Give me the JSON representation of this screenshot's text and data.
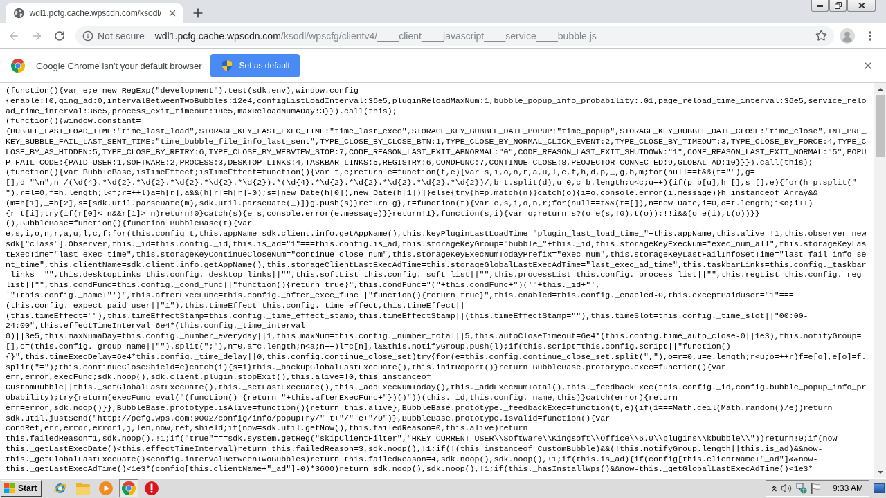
{
  "tabs": [
    {
      "title": "wdl1.pcfg.cache.wpscdn.com/ksodl/",
      "selected": true
    }
  ],
  "nav_buttons": [
    {
      "kind": "back",
      "disabled": true
    },
    {
      "kind": "forward",
      "disabled": true
    },
    {
      "kind": "reload",
      "disabled": false
    }
  ],
  "address_bar": {
    "security": "Not secure",
    "host": "wdl1.pcfg.cache.wpscdn.com",
    "path": "/ksodl/wpscfg/clientv4/____client____javascript____service____bubble.js"
  },
  "infobar": {
    "message": "Google Chrome isn't your default browser",
    "button": "Set as default"
  },
  "source_lines": [
    "(function(){var e;e=new RegExp(\"development\").test(sdk.env),window.config=",
    "{enable:!0,qing_ad:0,intervalBetweenTwoBubbles:12e4,configListLoadInterval:36e5,pluginReloadMaxNum:1,bubble_popup_info_probability:.01,page_reload_time_interval:36e5,service_relo",
    "ad_time_interval:36e5,process_exit_timeout:18e5,maxReloadNumADay:3}}).call(this);",
    "(function(){window.constant=",
    "{BUBBLE_LAST_LOAD_TIME:\"time_last_load\",STORAGE_KEY_LAST_EXEC_TIME:\"time_last_exec\",STORAGE_KEY_BUBBLE_DATE_POPUP:\"time_popup\",STORAGE_KEY_BUBBLE_DATE_CLOSE:\"time_close\",INI_PRE_",
    "KEY_BUBBLE_FAIL_LAST_SENT_TIME:\"time_bubble_file_info_last_sent\",TYPE_CLOSE_BY_CLOSE_BTN:1,TYPE_CLOSE_BY_NORMAL_CLICK_EVENT:2,TYPE_CLOSE_BY_TIMEOUT:3,TYPE_CLOSE_BY_FORCE:4,TYPE_C",
    "LOSE_BY_AS_HIDDEN:5,TYPE_CLOSE_BY_RETRY:6,TYPE_CLOSE_BY_WEBVIEW_STOP:7,CODE_REASON_LAST_EXIT_ABNORMAL:\"0\",CODE_REASON_LAST_EXIT_SHUTDOWN:\"1\",CONE_REASON_LAST_EXIT_NORMAL:\"5\",POPU",
    "P_FAIL_CODE:{PAID_USER:1,SOFTWARE:2,PROCESS:3,DESKTOP_LINKS:4,TASKBAR_LINKS:5,REGISTRY:6,CONDFUNC:7,CONTINUE_CLOSE:8,PEOJECTOR_CONNECTED:9,GLOBAL_AD:10}}}).call(this);",
    "(function(){var BubbleBase,isTimeEffect;isTimeEffect=function(){var t,e;return e=function(t,e){var s,i,o,n,r,a,u,l,c,f,h,d,p,_,g,b,m;for(null==t&&(t=\"\"),g=",
    "[],d=\"\\n\",n=/(\\d{4}.*\\d{2}.*\\d{2}.*\\d{2}.*\\d{2}.*\\d{2}).*(\\d{4}.*\\d{2}.*\\d{2}.*\\d{2}.*\\d{2}.*\\d{2})/,b=t.split(d),u=0,c=b.length;u<c;u++){if(p=b[u],h=[],s=[],e){for(h=p.split(\"-",
    "\"),r=l=0,f=h.length;l<f;r=++l)a=h[r],a&&(h[r]=h[r]-0);s=[new Date(h[0]),new Date(h[1])]}else{try{h=p.match(n)}catch(o){i=o,console.error(i.message)}h instanceof Array&&",
    "(m=h[1],_=h[2],s=[sdk.util.parseDate(m),sdk.util.parseDate(_)]}g.push(s)}return g},t=function(t){var e,s,i,o,n,r;for(null==t&&(t=[]),n=new Date,i=0,o=t.length;i<o;i++)",
    "{r=t[i];try{if(r[0]<=n&&r[1]>=n)return!0}catch(s){e=s,console.error(e.message)}}return!1},function(s,i){var o;return s?(o=e(s,!0),t(o)):!!i&&(o=e(i),t(o))}}",
    "(),BubbleBase=function(){function BubbleBase(t){var",
    "e,s,i,o,n,r,a,u,l,c,f;for(this.config=t,this.appName=sdk.client.info.getAppName(),this.keyPluginLastLoadTime=\"plugin_last_load_time_\"+this.appName,this.alive=!1,this.observer=new",
    "sdk[\"class\"].Observer,this._id=this.config._id,this.is_ad=\"1\"===this.config.is_ad,this.storageKeyGroup=\"bubble_\"+this._id,this.storageKeyExecNum=\"exec_num_all\",this.storageKeyLas",
    "tExecTime=\"last_exec_time\",this.storageKeyContinueCloseNum=\"continue_close_num\",this.storageKeyExecNumTodayPrefix=\"exec_num\",this.storageKeyLastFailInfoSetTime=\"last_fail_info_se",
    "nt_time\",this.clientName=sdk.client.info.getAppName(),this.storageClientLastExecAdTime=this.storageGlobalLastExecAdTime=\"last_exec_ad_time\",this.taskbarLinks=this.config._taskbar",
    "_links||\"\",this.desktopLinks=this.config._desktop_links||\"\",this.softList=this.config._soft_list||\"\",this.processList=this.config._process_list||\"\",this.regList=this.config._reg_",
    "list||\"\",this.condFunc=this.config._cond_func||\"function(){return true}\",this.condFunc=\"(\"+this.condFunc+\")('\"+this._id+\"',",
    "'\"+this.config._name+\"')\",this.afterExecFunc=this.config._after_exec_func||\"function(){return true}\",this.enabled=this.config._enabled-0,this.exceptPaidUser=\"1\"===",
    "(this.config._expect_paid_user||\"1\"),this.timeEffect=this.config._time_effect,this.timeEffect||",
    "(this.timeEffect=\"\"),this.timeEffectStamp=this.config._time_effect_stamp,this.timeEffectStamp||(this.timeEffectStamp=\"\"),this.timeSlot=this.config._time_slot||\"00:00-",
    "24:00\",this.effectTimeInterval=6e4*(this.config._time_interval-",
    "0)||3e5,this.maxNumaDay=this.config._number_everyday||1,this.maxNum=this.config._number_total||5,this.autoCloseTimeout=6e4*(this.config.time_auto_close-0||1e3),this.notifyGroup=",
    "[],c=(this.config._group_name||\"\").split(\";\"),n=0,a=c.length;n<a;n++)l=c[n],l&&this.notifyGroup.push(l);if(this.script=this.config.script||\"function()",
    "{}\",this.timeExecDelay=6e4*this.config._time_delay||0,this.config.continue_close_set)try{for(e=this.config.continue_close_set.split(\",\"),o=r=0,u=e.length;r<u;o=++r)f=e[o],e[o]=f.",
    "split(\"=\");this.continueCloseShield=e}catch(i){s=i}this._backupGlobalLastExecDate(),this.initReport()}return BubbleBase.prototype.exec=function(){var",
    "err,error,execFunc;sdk.noop(),sdk.client.plugin.stopExit(),this.alive=!0,this instanceof",
    "CustomBubble||this._setGlobalLastExecDate(),this._setLastExecDate(),this._addExecNumToday(),this._addExecNumTotal(),this._feedbackExec(this.config._id,config.bubble_popup_info_pr",
    "obability);try{return(execFunc=eval(\"(function() {return \"+this.afterExecFunc+\"})()\"))(this._id,this.config._name,this)}catch(error){return",
    "err=error,sdk.noop()}},BubbleBase.prototype.isAlive=function(){return this.alive},BubbleBase.prototype._feedbackExec=function(t,e){if(1===Math.ceil(Math.random()/e))return",
    "sdk.util.justSend(\"http://pcfg.wps.com:9002/config/info/popupTry/\"+t+\"/\"+e+\"/0\")},BubbleBase.prototype.isValid=function(){var",
    "condRet,err,error,error1,j,len,now,ref,shield;if(now=sdk.util.getNow(),this.failedReason=0,this.alive)return",
    "this.failedReason=1,sdk.noop(),!1;if(\"true\"===sdk.system.getReg(\"skipClientFilter\",\"HKEY_CURRENT_USER\\\\Software\\\\Kingsoft\\\\Office\\\\6.0\\\\plugins\\\\kbubble\\\\\"))return!0;if(now-",
    "this._getLastExecDate()<this.effectTimeInterval)return this.failedReason=3,sdk.noop(),!1;if(!(this instanceof CustomBubble)&&(!this.notifyGroup.length||this.is_ad)&&now-",
    "this._getGlobalLastExecDate()<config.intervalBetweenTwoBubbles)return this.failedReason=4,sdk.noop(),sdk.noop(),!1;if(this.is_ad){if(config[this.clientName+\"_ad\"]&&now-",
    "this._getLastExecAdTime()<1e3*(config[this.clientName+\"_ad\"]-0)*3600)return sdk.noop(),sdk.noop(),!1;if(this._hasInstallWps()&&now-this._getGlobalLastExecAdTime()<1e3*"
  ],
  "taskbar": {
    "start": "Start",
    "items": [
      {
        "kind": "globe",
        "active": false
      },
      {
        "kind": "folder",
        "active": false
      },
      {
        "kind": "media",
        "active": false
      },
      {
        "kind": "browser",
        "active": true
      },
      {
        "kind": "alert",
        "active": false
      }
    ],
    "clock": "9:33 AM"
  }
}
